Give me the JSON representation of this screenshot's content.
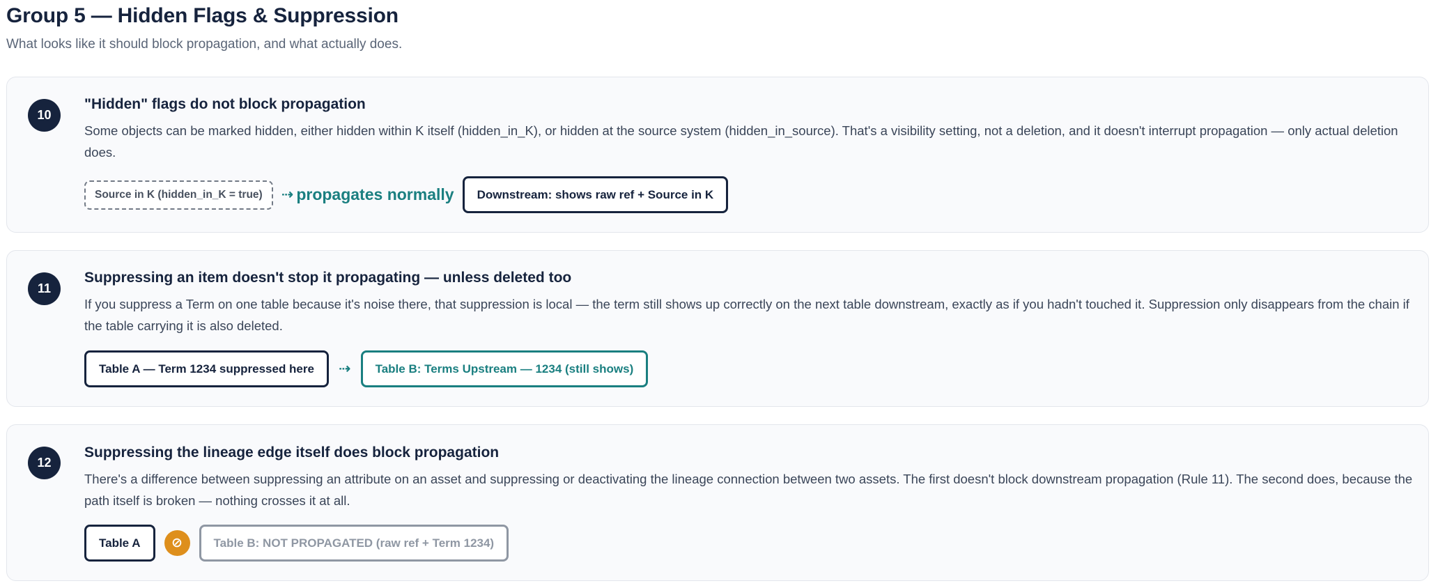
{
  "header": {
    "title": "Group 5 — Hidden Flags & Suppression",
    "subtitle": "What looks like it should block propagation, and what actually does."
  },
  "rules": [
    {
      "number": "10",
      "title": "\"Hidden\" flags do not block propagation",
      "description": "Some objects can be marked hidden, either hidden within K itself (hidden_in_K), or hidden at the source system (hidden_in_source). That's a visibility setting, not a deletion, and it doesn't interrupt propagation — only actual deletion does.",
      "flow": {
        "source": "Source in K (hidden_in_K = true)",
        "arrow": "⇢",
        "arrow_label": "propagates normally",
        "target": "Downstream: shows raw ref + Source in K"
      }
    },
    {
      "number": "11",
      "title": "Suppressing an item doesn't stop it propagating — unless deleted too",
      "description": "If you suppress a Term on one table because it's noise there, that suppression is local — the term still shows up correctly on the next table downstream, exactly as if you hadn't touched it. Suppression only disappears from the chain if the table carrying it is also deleted.",
      "flow": {
        "source": "Table A — Term 1234 suppressed here",
        "arrow": "⇢",
        "target": "Table B: Terms Upstream — 1234 (still shows)"
      }
    },
    {
      "number": "12",
      "title": "Suppressing the lineage edge itself does block propagation",
      "description": "There's a difference between suppressing an attribute on an asset and suppressing or deactivating the lineage connection between two assets. The first doesn't block downstream propagation (Rule 11). The second does, because the path itself is broken — nothing crosses it at all.",
      "flow": {
        "source": "Table A",
        "blocked_symbol": "⊘",
        "target": "Table B: NOT PROPAGATED (raw ref + Term 1234)"
      }
    }
  ],
  "colors": {
    "navy": "#16233d",
    "teal": "#1a7f80",
    "amber": "#de8f1c",
    "grey": "#8f97a3",
    "card_bg": "#f9fafc"
  },
  "icons": {
    "arrow": "dashed-arrow-icon",
    "blocked": "blocked-icon"
  }
}
